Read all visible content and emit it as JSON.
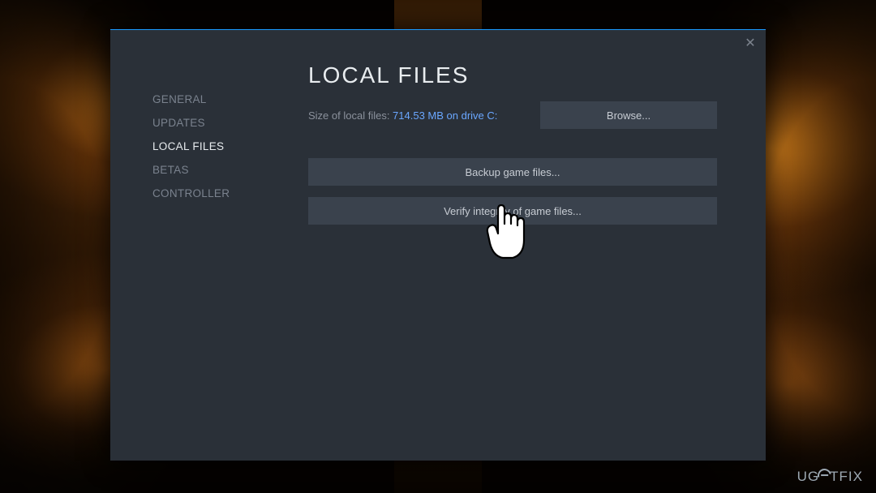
{
  "sidebar": {
    "items": [
      {
        "label": "GENERAL",
        "selected": false
      },
      {
        "label": "UPDATES",
        "selected": false
      },
      {
        "label": "LOCAL FILES",
        "selected": true
      },
      {
        "label": "BETAS",
        "selected": false
      },
      {
        "label": "CONTROLLER",
        "selected": false
      }
    ]
  },
  "content": {
    "title": "LOCAL FILES",
    "size_label": "Size of local files: ",
    "size_value": "714.53 MB on drive C:",
    "browse_label": "Browse...",
    "backup_label": "Backup game files...",
    "verify_label": "Verify integrity of game files..."
  },
  "watermark": {
    "prefix": "UG",
    "suffix": "TFIX"
  }
}
